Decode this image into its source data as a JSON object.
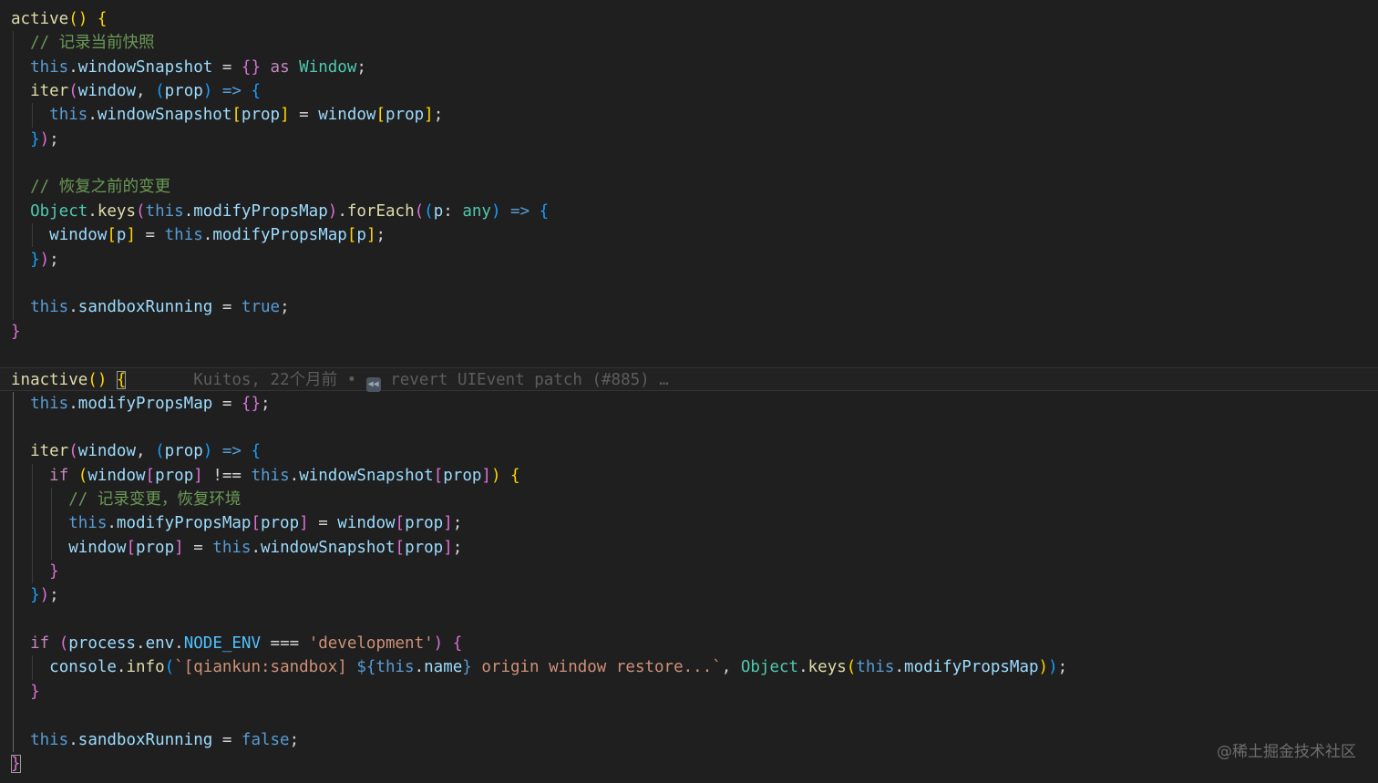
{
  "theme": {
    "background": "#1f1f1f",
    "colors": {
      "fn": "#dcdcaa",
      "var": "#9cdcfe",
      "kw": "#569cd6",
      "ctl": "#c586c0",
      "type": "#4ec9b0",
      "str": "#ce9178",
      "cmt": "#6a9955",
      "const": "#4fc1ff",
      "p": "#d4d4d4",
      "b1": "#ffd700",
      "b2": "#da70d6",
      "b3": "#179fff",
      "plain": "#d4d4d4"
    }
  },
  "code": {
    "lines": [
      [
        [
          "fn",
          "active"
        ],
        [
          "b1",
          "()"
        ],
        [
          "p",
          " "
        ],
        [
          "b1",
          "{"
        ]
      ],
      [
        [
          "p",
          "  "
        ],
        [
          "cmt",
          "// 记录当前快照"
        ]
      ],
      [
        [
          "p",
          "  "
        ],
        [
          "kw",
          "this"
        ],
        [
          "p",
          "."
        ],
        [
          "var",
          "windowSnapshot"
        ],
        [
          "p",
          " = "
        ],
        [
          "b2",
          "{}"
        ],
        [
          "p",
          " "
        ],
        [
          "ctl",
          "as"
        ],
        [
          "p",
          " "
        ],
        [
          "type",
          "Window"
        ],
        [
          "p",
          ";"
        ]
      ],
      [
        [
          "p",
          "  "
        ],
        [
          "fn",
          "iter"
        ],
        [
          "b2",
          "("
        ],
        [
          "var",
          "window"
        ],
        [
          "p",
          ", "
        ],
        [
          "b3",
          "("
        ],
        [
          "var",
          "prop"
        ],
        [
          "b3",
          ")"
        ],
        [
          "p",
          " "
        ],
        [
          "kw",
          "=>"
        ],
        [
          "p",
          " "
        ],
        [
          "b3",
          "{"
        ]
      ],
      [
        [
          "p",
          "    "
        ],
        [
          "kw",
          "this"
        ],
        [
          "p",
          "."
        ],
        [
          "var",
          "windowSnapshot"
        ],
        [
          "b1",
          "["
        ],
        [
          "var",
          "prop"
        ],
        [
          "b1",
          "]"
        ],
        [
          "p",
          " = "
        ],
        [
          "var",
          "window"
        ],
        [
          "b1",
          "["
        ],
        [
          "var",
          "prop"
        ],
        [
          "b1",
          "]"
        ],
        [
          "p",
          ";"
        ]
      ],
      [
        [
          "p",
          "  "
        ],
        [
          "b3",
          "}"
        ],
        [
          "b2",
          ")"
        ],
        [
          "p",
          ";"
        ]
      ],
      [],
      [
        [
          "p",
          "  "
        ],
        [
          "cmt",
          "// 恢复之前的变更"
        ]
      ],
      [
        [
          "p",
          "  "
        ],
        [
          "type",
          "Object"
        ],
        [
          "p",
          "."
        ],
        [
          "fn",
          "keys"
        ],
        [
          "b2",
          "("
        ],
        [
          "kw",
          "this"
        ],
        [
          "p",
          "."
        ],
        [
          "var",
          "modifyPropsMap"
        ],
        [
          "b2",
          ")"
        ],
        [
          "p",
          "."
        ],
        [
          "fn",
          "forEach"
        ],
        [
          "b2",
          "("
        ],
        [
          "b3",
          "("
        ],
        [
          "var",
          "p"
        ],
        [
          "p",
          ": "
        ],
        [
          "type",
          "any"
        ],
        [
          "b3",
          ")"
        ],
        [
          "p",
          " "
        ],
        [
          "kw",
          "=>"
        ],
        [
          "p",
          " "
        ],
        [
          "b3",
          "{"
        ]
      ],
      [
        [
          "p",
          "    "
        ],
        [
          "var",
          "window"
        ],
        [
          "b1",
          "["
        ],
        [
          "var",
          "p"
        ],
        [
          "b1",
          "]"
        ],
        [
          "p",
          " = "
        ],
        [
          "kw",
          "this"
        ],
        [
          "p",
          "."
        ],
        [
          "var",
          "modifyPropsMap"
        ],
        [
          "b1",
          "["
        ],
        [
          "var",
          "p"
        ],
        [
          "b1",
          "]"
        ],
        [
          "p",
          ";"
        ]
      ],
      [
        [
          "p",
          "  "
        ],
        [
          "b3",
          "}"
        ],
        [
          "b2",
          ")"
        ],
        [
          "p",
          ";"
        ]
      ],
      [],
      [
        [
          "p",
          "  "
        ],
        [
          "kw",
          "this"
        ],
        [
          "p",
          "."
        ],
        [
          "var",
          "sandboxRunning"
        ],
        [
          "p",
          " = "
        ],
        [
          "kw",
          "true"
        ],
        [
          "p",
          ";"
        ]
      ],
      [
        [
          "b2",
          "}"
        ]
      ],
      [],
      [
        [
          "fn",
          "inactive"
        ],
        [
          "b1",
          "()"
        ],
        [
          "p",
          " "
        ],
        [
          "b1",
          "{",
          "bm"
        ],
        [
          "blame",
          "       Kuitos, 22个月前 • "
        ],
        [
          "blameicon",
          "◀◀"
        ],
        [
          "blame",
          " revert UIEvent patch (#885) …"
        ]
      ],
      [
        [
          "p",
          "  "
        ],
        [
          "kw",
          "this"
        ],
        [
          "p",
          "."
        ],
        [
          "var",
          "modifyPropsMap"
        ],
        [
          "p",
          " = "
        ],
        [
          "b2",
          "{}"
        ],
        [
          "p",
          ";"
        ]
      ],
      [],
      [
        [
          "p",
          "  "
        ],
        [
          "fn",
          "iter"
        ],
        [
          "b2",
          "("
        ],
        [
          "var",
          "window"
        ],
        [
          "p",
          ", "
        ],
        [
          "b3",
          "("
        ],
        [
          "var",
          "prop"
        ],
        [
          "b3",
          ")"
        ],
        [
          "p",
          " "
        ],
        [
          "kw",
          "=>"
        ],
        [
          "p",
          " "
        ],
        [
          "b3",
          "{"
        ]
      ],
      [
        [
          "p",
          "    "
        ],
        [
          "ctl",
          "if"
        ],
        [
          "p",
          " "
        ],
        [
          "b1",
          "("
        ],
        [
          "var",
          "window"
        ],
        [
          "b2",
          "["
        ],
        [
          "var",
          "prop"
        ],
        [
          "b2",
          "]"
        ],
        [
          "p",
          " !== "
        ],
        [
          "kw",
          "this"
        ],
        [
          "p",
          "."
        ],
        [
          "var",
          "windowSnapshot"
        ],
        [
          "b2",
          "["
        ],
        [
          "var",
          "prop"
        ],
        [
          "b2",
          "]"
        ],
        [
          "b1",
          ")"
        ],
        [
          "p",
          " "
        ],
        [
          "b1",
          "{"
        ]
      ],
      [
        [
          "p",
          "      "
        ],
        [
          "cmt",
          "// 记录变更，恢复环境"
        ]
      ],
      [
        [
          "p",
          "      "
        ],
        [
          "kw",
          "this"
        ],
        [
          "p",
          "."
        ],
        [
          "var",
          "modifyPropsMap"
        ],
        [
          "b2",
          "["
        ],
        [
          "var",
          "prop"
        ],
        [
          "b2",
          "]"
        ],
        [
          "p",
          " = "
        ],
        [
          "var",
          "window"
        ],
        [
          "b2",
          "["
        ],
        [
          "var",
          "prop"
        ],
        [
          "b2",
          "]"
        ],
        [
          "p",
          ";"
        ]
      ],
      [
        [
          "p",
          "      "
        ],
        [
          "var",
          "window"
        ],
        [
          "b2",
          "["
        ],
        [
          "var",
          "prop"
        ],
        [
          "b2",
          "]"
        ],
        [
          "p",
          " = "
        ],
        [
          "kw",
          "this"
        ],
        [
          "p",
          "."
        ],
        [
          "var",
          "windowSnapshot"
        ],
        [
          "b2",
          "["
        ],
        [
          "var",
          "prop"
        ],
        [
          "b2",
          "]"
        ],
        [
          "p",
          ";"
        ]
      ],
      [
        [
          "p",
          "    "
        ],
        [
          "b2",
          "}"
        ]
      ],
      [
        [
          "p",
          "  "
        ],
        [
          "b3",
          "}"
        ],
        [
          "b2",
          ")"
        ],
        [
          "p",
          ";"
        ]
      ],
      [],
      [
        [
          "p",
          "  "
        ],
        [
          "ctl",
          "if"
        ],
        [
          "p",
          " "
        ],
        [
          "b2",
          "("
        ],
        [
          "var",
          "process"
        ],
        [
          "p",
          "."
        ],
        [
          "var",
          "env"
        ],
        [
          "p",
          "."
        ],
        [
          "const",
          "NODE_ENV"
        ],
        [
          "p",
          " === "
        ],
        [
          "str",
          "'development'"
        ],
        [
          "b2",
          ")"
        ],
        [
          "p",
          " "
        ],
        [
          "b2",
          "{"
        ]
      ],
      [
        [
          "p",
          "    "
        ],
        [
          "var",
          "console"
        ],
        [
          "p",
          "."
        ],
        [
          "fn",
          "info"
        ],
        [
          "b3",
          "("
        ],
        [
          "str",
          "`[qiankun:sandbox] "
        ],
        [
          "kw",
          "${"
        ],
        [
          "kw",
          "this"
        ],
        [
          "p",
          "."
        ],
        [
          "var",
          "name"
        ],
        [
          "kw",
          "}"
        ],
        [
          "str",
          " origin window restore...`"
        ],
        [
          "p",
          ", "
        ],
        [
          "type",
          "Object"
        ],
        [
          "p",
          "."
        ],
        [
          "fn",
          "keys"
        ],
        [
          "b1",
          "("
        ],
        [
          "kw",
          "this"
        ],
        [
          "p",
          "."
        ],
        [
          "var",
          "modifyPropsMap"
        ],
        [
          "b1",
          ")"
        ],
        [
          "b3",
          ")"
        ],
        [
          "p",
          ";"
        ]
      ],
      [
        [
          "p",
          "  "
        ],
        [
          "b2",
          "}"
        ]
      ],
      [],
      [
        [
          "p",
          "  "
        ],
        [
          "kw",
          "this"
        ],
        [
          "p",
          "."
        ],
        [
          "var",
          "sandboxRunning"
        ],
        [
          "p",
          " = "
        ],
        [
          "kw",
          "false"
        ],
        [
          "p",
          ";"
        ]
      ],
      [
        [
          "b2",
          "}",
          "bm"
        ]
      ]
    ]
  },
  "watermark": "@稀土掘金技术社区"
}
